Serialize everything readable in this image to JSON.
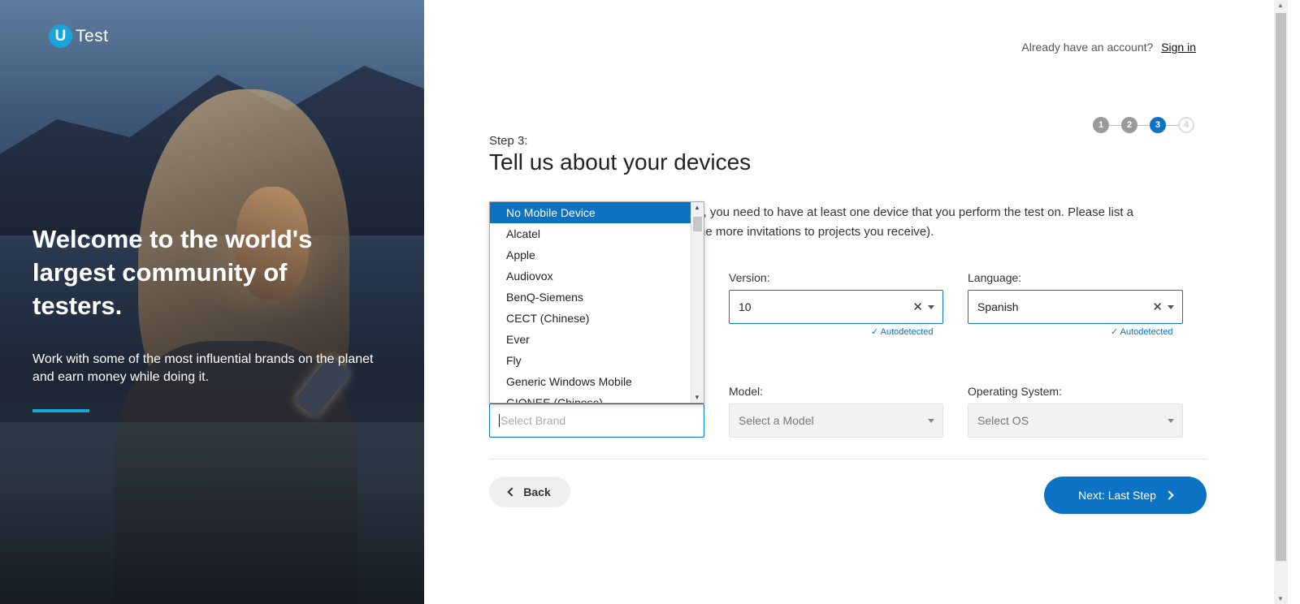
{
  "hero": {
    "logo_letter": "U",
    "logo_text": "Test",
    "headline": "Welcome to the world's largest community of testers.",
    "subtext": "Work with some of the most influential brands on the planet and earn money while doing it."
  },
  "header": {
    "account_prompt": "Already have an account?",
    "signin_label": "Sign in"
  },
  "steps": [
    "1",
    "2",
    "3",
    "4"
  ],
  "form": {
    "step_label": "Step 3:",
    "title": "Tell us about your devices",
    "desc_line1": "s, you need to have at least one device that you perform the test on. Please list a",
    "desc_line2": "he more invitations to projects you receive).",
    "version": {
      "label": "Version:",
      "value": "10",
      "autodetected": "✓ Autodetected"
    },
    "language": {
      "label": "Language:",
      "value": "Spanish",
      "autodetected": "✓ Autodetected"
    },
    "brand": {
      "placeholder": "Select Brand"
    },
    "model": {
      "label": "Model:",
      "placeholder": "Select a Model"
    },
    "os": {
      "label": "Operating System:",
      "placeholder": "Select OS"
    },
    "back_label": "Back",
    "next_label": "Next: Last Step"
  },
  "brand_dropdown": {
    "items": [
      "No Mobile Device",
      "Alcatel",
      "Apple",
      "Audiovox",
      "BenQ-Siemens",
      "CECT (Chinese)",
      "Ever",
      "Fly",
      "Generic Windows Mobile",
      "GIONEE (Chinese)"
    ],
    "selected": "No Mobile Device"
  },
  "colors": {
    "accent": "#0b72c4",
    "logo": "#1aa4d8"
  }
}
